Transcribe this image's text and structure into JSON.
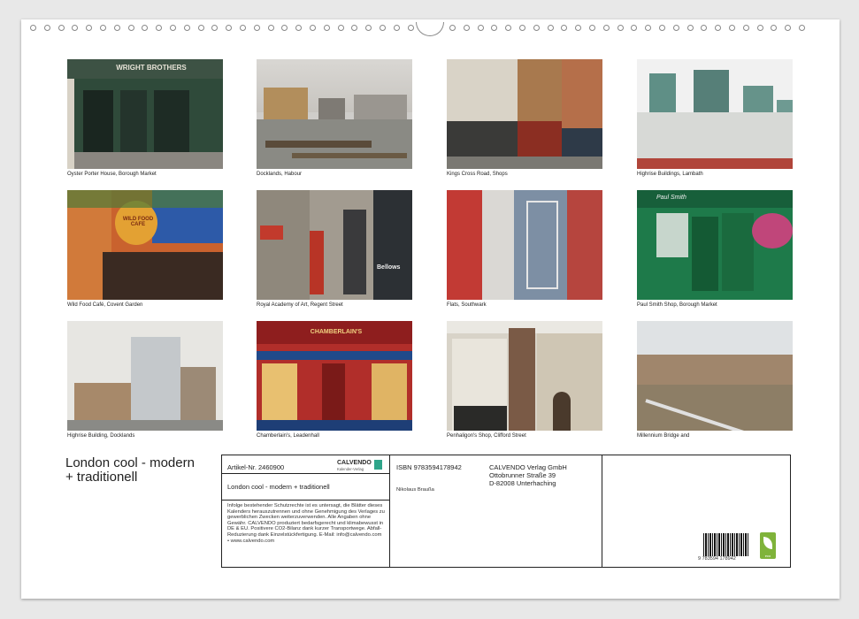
{
  "photos": [
    {
      "caption": "Oyster Porter House, Borough Market",
      "sign": "WRIGHT BROTHERS"
    },
    {
      "caption": "Docklands, Habour"
    },
    {
      "caption": "Kings Cross Road, Shops"
    },
    {
      "caption": "Highrise Buildings, Lambath"
    },
    {
      "caption": "Wild Food Café, Covent Garden",
      "sign": "WILD FOOD CAFE"
    },
    {
      "caption": "Royal Academy of Art, Regent Street",
      "sign": "Bellows"
    },
    {
      "caption": "Flats, Southwark"
    },
    {
      "caption": "Paul Smith Shop, Borough Market",
      "sign": "Paul Smith"
    },
    {
      "caption": "Highrise Building, Docklands"
    },
    {
      "caption": "Chamberlain's, Leadenhall",
      "sign": "CHAMBERLAIN'S"
    },
    {
      "caption": "Penhaligon's Shop, Clifford Street"
    },
    {
      "caption": "Millennium Bridge and"
    }
  ],
  "cover": {
    "title_line1": "London cool - modern",
    "title_line2": "+ traditionell"
  },
  "info": {
    "article": "Artikel-Nr. 2460900",
    "brand": "CALVENDO",
    "brand_sub": "Kalender-Verlag",
    "subtitle": "London cool - modern + traditionell",
    "legal": "Infolge bestehender Schutzrechte ist es untersagt, die Blätter dieses Kalenders herauszutrennen und ohne Genehmigung des Verlages zu gewerblichen Zwecken weiterzuverwenden. Alle Angaben ohne Gewähr. CALVENDO produziert bedarfsgerecht und klimabewusst in DE & EU. Positivere CO2-Bilanz dank kurzer Transportwege. Abfall-Reduzierung dank Einzelstückfertigung. E-Mail: info@calvendo.com • www.calvendo.com",
    "isbn": "ISBN 9783594178942",
    "publisher_name": "CALVENDO Verlag GmbH",
    "publisher_street": "Ottobrunner Straße 39",
    "publisher_city": "D-82008 Unterhaching",
    "author": "Nikolaus Braußa",
    "barcode_number": "9 783594 178942",
    "eco_label": "eco"
  }
}
